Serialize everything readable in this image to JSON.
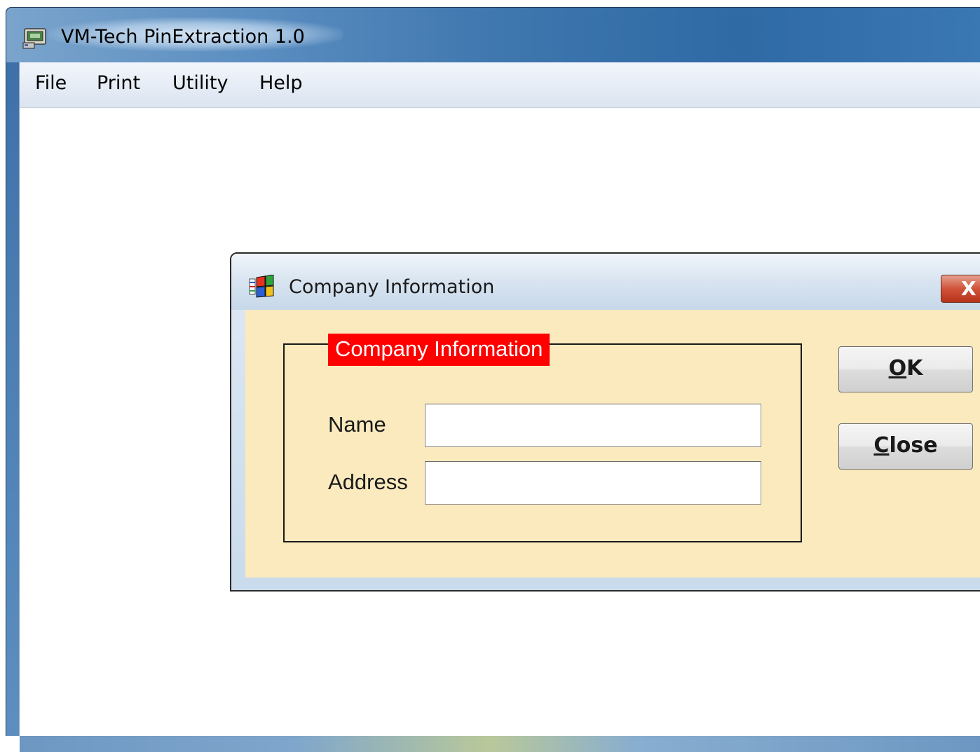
{
  "app": {
    "title": "VM-Tech PinExtraction 1.0",
    "icon": "app-window-icon"
  },
  "menubar": {
    "items": [
      {
        "label": "File"
      },
      {
        "label": "Print"
      },
      {
        "label": "Utility"
      },
      {
        "label": "Help"
      }
    ]
  },
  "dialog": {
    "title": "Company Information",
    "icon": "windows-flag-icon",
    "close_glyph": "X",
    "group": {
      "legend": "Company Information",
      "fields": [
        {
          "label": "Name",
          "value": ""
        },
        {
          "label": "Address",
          "value": ""
        }
      ]
    },
    "buttons": {
      "ok": {
        "mnemonic": "O",
        "rest": "K"
      },
      "close": {
        "mnemonic": "C",
        "rest": "lose"
      }
    }
  },
  "colors": {
    "dialog_body": "#faeabe",
    "legend_bg": "#ff0000",
    "legend_text": "#ffffff",
    "titlebar_accent": "#3f77ae"
  }
}
